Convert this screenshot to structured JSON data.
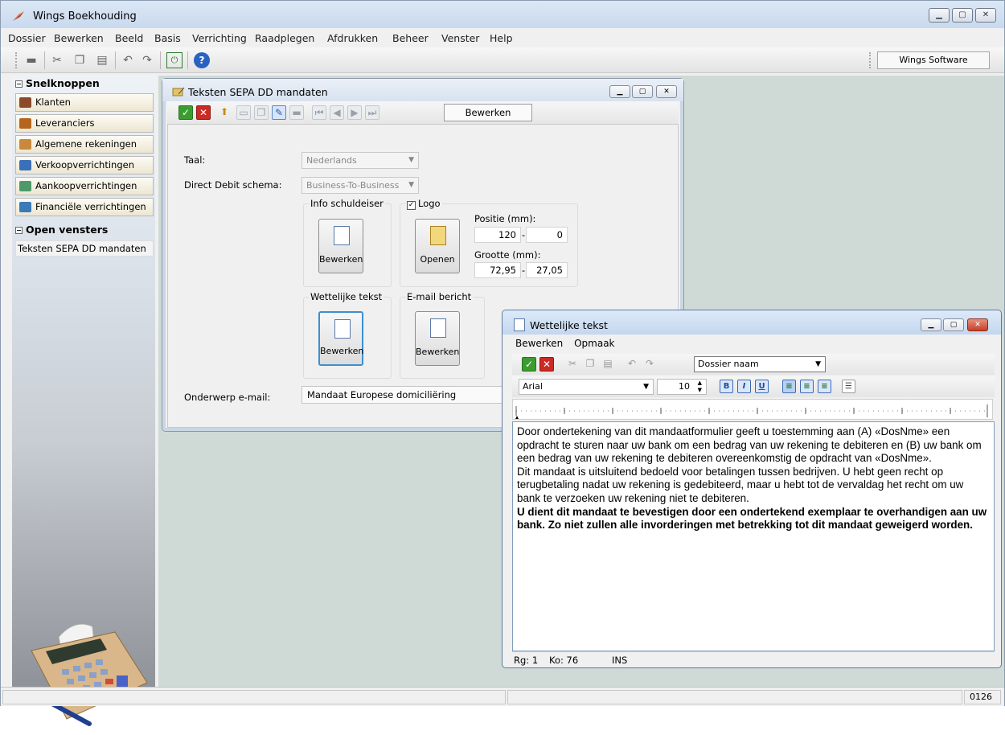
{
  "app": {
    "title": "Wings Boekhouding",
    "company": "Wings Software"
  },
  "menu": [
    "Dossier",
    "Bewerken",
    "Beeld",
    "Basis",
    "Verrichting",
    "Raadplegen",
    "Afdrukken",
    "Beheer",
    "Venster",
    "Help"
  ],
  "sidebar": {
    "section1": "Snelknoppen",
    "items": [
      {
        "label": "Klanten",
        "icon": "customers-icon",
        "color": "#8b4a2b"
      },
      {
        "label": "Leveranciers",
        "icon": "suppliers-icon",
        "color": "#b5651d"
      },
      {
        "label": "Algemene rekeningen",
        "icon": "ledger-icon",
        "color": "#c88a3a"
      },
      {
        "label": "Verkoopverrichtingen",
        "icon": "sales-icon",
        "color": "#3a70b8"
      },
      {
        "label": "Aankoopverrichtingen",
        "icon": "purchase-icon",
        "color": "#4c9a6a"
      },
      {
        "label": "Financiële verrichtingen",
        "icon": "finance-icon",
        "color": "#3a7ab8"
      }
    ],
    "section2": "Open vensters",
    "open_windows": [
      "Teksten SEPA DD mandaten"
    ]
  },
  "status": {
    "right": "0126"
  },
  "sepa_window": {
    "title": "Teksten SEPA DD mandaten",
    "mode": "Bewerken",
    "fields": {
      "taal_label": "Taal:",
      "taal_value": "Nederlands",
      "schema_label": "Direct Debit schema:",
      "schema_value": "Business-To-Business",
      "subject_label": "Onderwerp e-mail:",
      "subject_value": "Mandaat Europese domiciliëring"
    },
    "groups": {
      "info_title": "Info schuldeiser",
      "info_button": "Bewerken",
      "logo_title": "Logo",
      "logo_button": "Openen",
      "position_label": "Positie (mm):",
      "pos_x": "120",
      "pos_y": "0",
      "size_label": "Grootte (mm):",
      "size_w": "72,95",
      "size_h": "27,05",
      "legal_title": "Wettelijke tekst",
      "legal_button": "Bewerken",
      "email_title": "E-mail bericht",
      "email_button": "Bewerken"
    }
  },
  "legal_window": {
    "title": "Wettelijke tekst",
    "menu": [
      "Bewerken",
      "Opmaak"
    ],
    "field_select": "Dossier naam",
    "font": "Arial",
    "font_size": "10",
    "text_paragraphs": [
      "Door ondertekening van dit mandaatformulier geeft u toestemming aan (A) «DosNme» een opdracht te sturen naar uw bank om een bedrag van uw rekening te debiteren en (B) uw bank om een bedrag van uw rekening te debiteren overeenkomstig de opdracht van «DosNme».",
      "Dit mandaat is uitsluitend bedoeld voor betalingen tussen bedrijven. U hebt geen recht op terugbetaling nadat uw rekening is gedebiteerd, maar u hebt tot de vervaldag het recht om uw bank te verzoeken uw rekening niet te debiteren."
    ],
    "bold_paragraph": "U dient dit mandaat te bevestigen door een ondertekend exemplaar te overhandigen aan uw bank. Zo niet zullen alle invorderingen met betrekking tot dit mandaat geweigerd worden.",
    "status": {
      "row": "Rg: 1",
      "col": "Ko: 76",
      "mode": "INS"
    }
  }
}
